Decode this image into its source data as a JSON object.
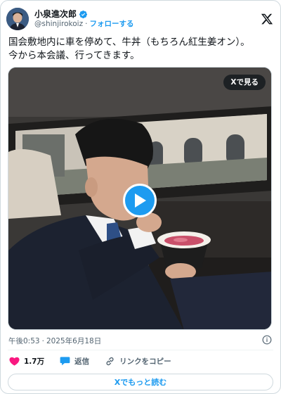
{
  "author": {
    "display_name": "小泉進次郎",
    "handle": "@shinjirokoiz",
    "follow_label": "フォローする",
    "verified_color": "#1d9bf0"
  },
  "tweet": {
    "line1": "国会敷地内に車を停めて、牛丼（もちろん紅生姜オン）。",
    "line2": "今から本会議、行ってきます。"
  },
  "media": {
    "view_on_x_label": "Xで見る",
    "play_icon": "play-icon"
  },
  "meta": {
    "time": "午後0:53",
    "separator": "·",
    "date": "2025年6月18日"
  },
  "actions": {
    "like_count": "1.7万",
    "reply_label": "返信",
    "copy_link_label": "リンクをコピー",
    "like_color": "#f91880"
  },
  "read_more_label": "Xでもっと読む",
  "colors": {
    "accent": "#1d9bf0",
    "text": "#0f1419",
    "muted": "#536471"
  }
}
